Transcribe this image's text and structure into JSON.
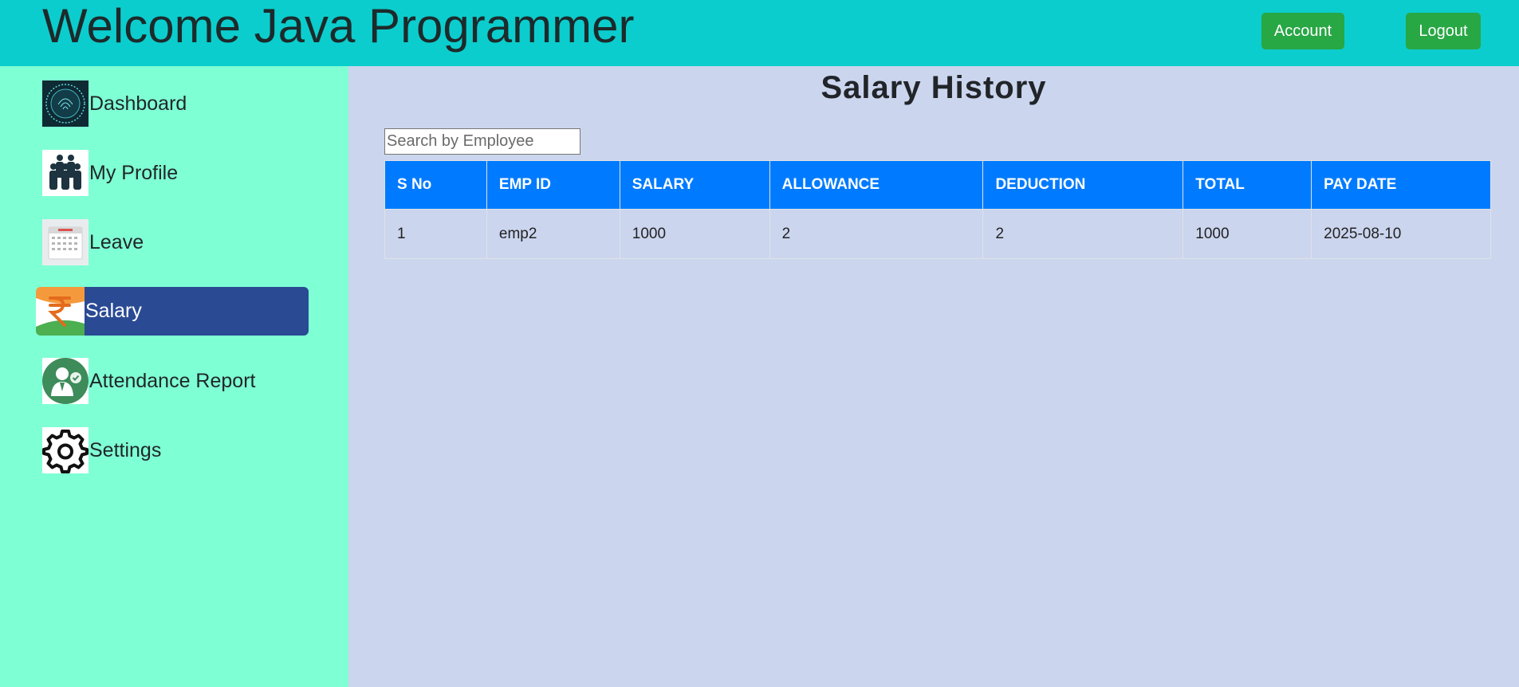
{
  "header": {
    "title": "Welcome Java Programmer",
    "account_label": "Account",
    "logout_label": "Logout",
    "accent_color": "#0ccdcd",
    "button_color": "#28a745"
  },
  "sidebar": {
    "background": "#7fffd4",
    "active_color": "#2a4a94",
    "items": [
      {
        "label": "Dashboard",
        "icon": "fingerprint-icon"
      },
      {
        "label": "My Profile",
        "icon": "people-icon"
      },
      {
        "label": "Leave",
        "icon": "calendar-icon"
      },
      {
        "label": "Salary",
        "icon": "rupee-icon",
        "active": true
      },
      {
        "label": "Attendance Report",
        "icon": "user-check-icon"
      },
      {
        "label": "Settings",
        "icon": "gear-icon"
      }
    ]
  },
  "main": {
    "title": "Salary History",
    "search": {
      "placeholder": "Search by Employee",
      "value": ""
    },
    "table": {
      "header_color": "#007bff",
      "columns": [
        "S No",
        "EMP ID",
        "SALARY",
        "ALLOWANCE",
        "DEDUCTION",
        "TOTAL",
        "PAY DATE"
      ],
      "rows": [
        [
          "1",
          "emp2",
          "1000",
          "2",
          "2",
          "1000",
          "2025-08-10"
        ]
      ]
    }
  }
}
